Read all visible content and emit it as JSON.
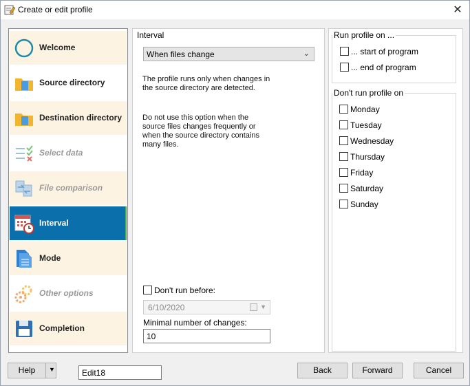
{
  "window": {
    "title": "Create or edit profile",
    "close_glyph": "✕"
  },
  "nav": {
    "items": [
      {
        "label": "Welcome",
        "icon": "welcome-circle-icon",
        "state": "normal"
      },
      {
        "label": "Source directory",
        "icon": "folder-icon",
        "state": "plain"
      },
      {
        "label": "Destination directory",
        "icon": "folder-icon",
        "state": "normal"
      },
      {
        "label": "Select data",
        "icon": "select-data-icon",
        "state": "disabled"
      },
      {
        "label": "File comparison",
        "icon": "file-comparison-icon",
        "state": "disabled"
      },
      {
        "label": "Interval",
        "icon": "calendar-clock-icon",
        "state": "active"
      },
      {
        "label": "Mode",
        "icon": "document-icon",
        "state": "normal"
      },
      {
        "label": "Other options",
        "icon": "gears-icon",
        "state": "disabled"
      },
      {
        "label": "Completion",
        "icon": "floppy-disk-icon",
        "state": "normal"
      }
    ]
  },
  "interval": {
    "group_label": "Interval",
    "selected": "When files change",
    "desc1": "The profile runs only when changes in\nthe source directory are detected.",
    "desc2": "Do not use this option when the\nsource files changes frequently or\nwhen the source directory contains\nmany files.",
    "dont_run_before_label": "Don't run before:",
    "date_value": "6/10/2020",
    "min_changes_label": "Minimal number of changes:",
    "min_changes_value": "10"
  },
  "run_on": {
    "group_label": "Run profile on ...",
    "start_label": "... start of program",
    "end_label": "... end of program"
  },
  "dont_run_on": {
    "group_label": "Don't run profile on",
    "days": [
      "Monday",
      "Tuesday",
      "Wednesday",
      "Thursday",
      "Friday",
      "Saturday",
      "Sunday"
    ]
  },
  "footer": {
    "help_label": "Help",
    "edit_value": "Edit18",
    "back_label": "Back",
    "forward_label": "Forward",
    "cancel_label": "Cancel"
  },
  "colors": {
    "active_nav": "#0a6fab",
    "nav_bg": "#fdf3e2",
    "accent_green": "#3fb04a"
  }
}
